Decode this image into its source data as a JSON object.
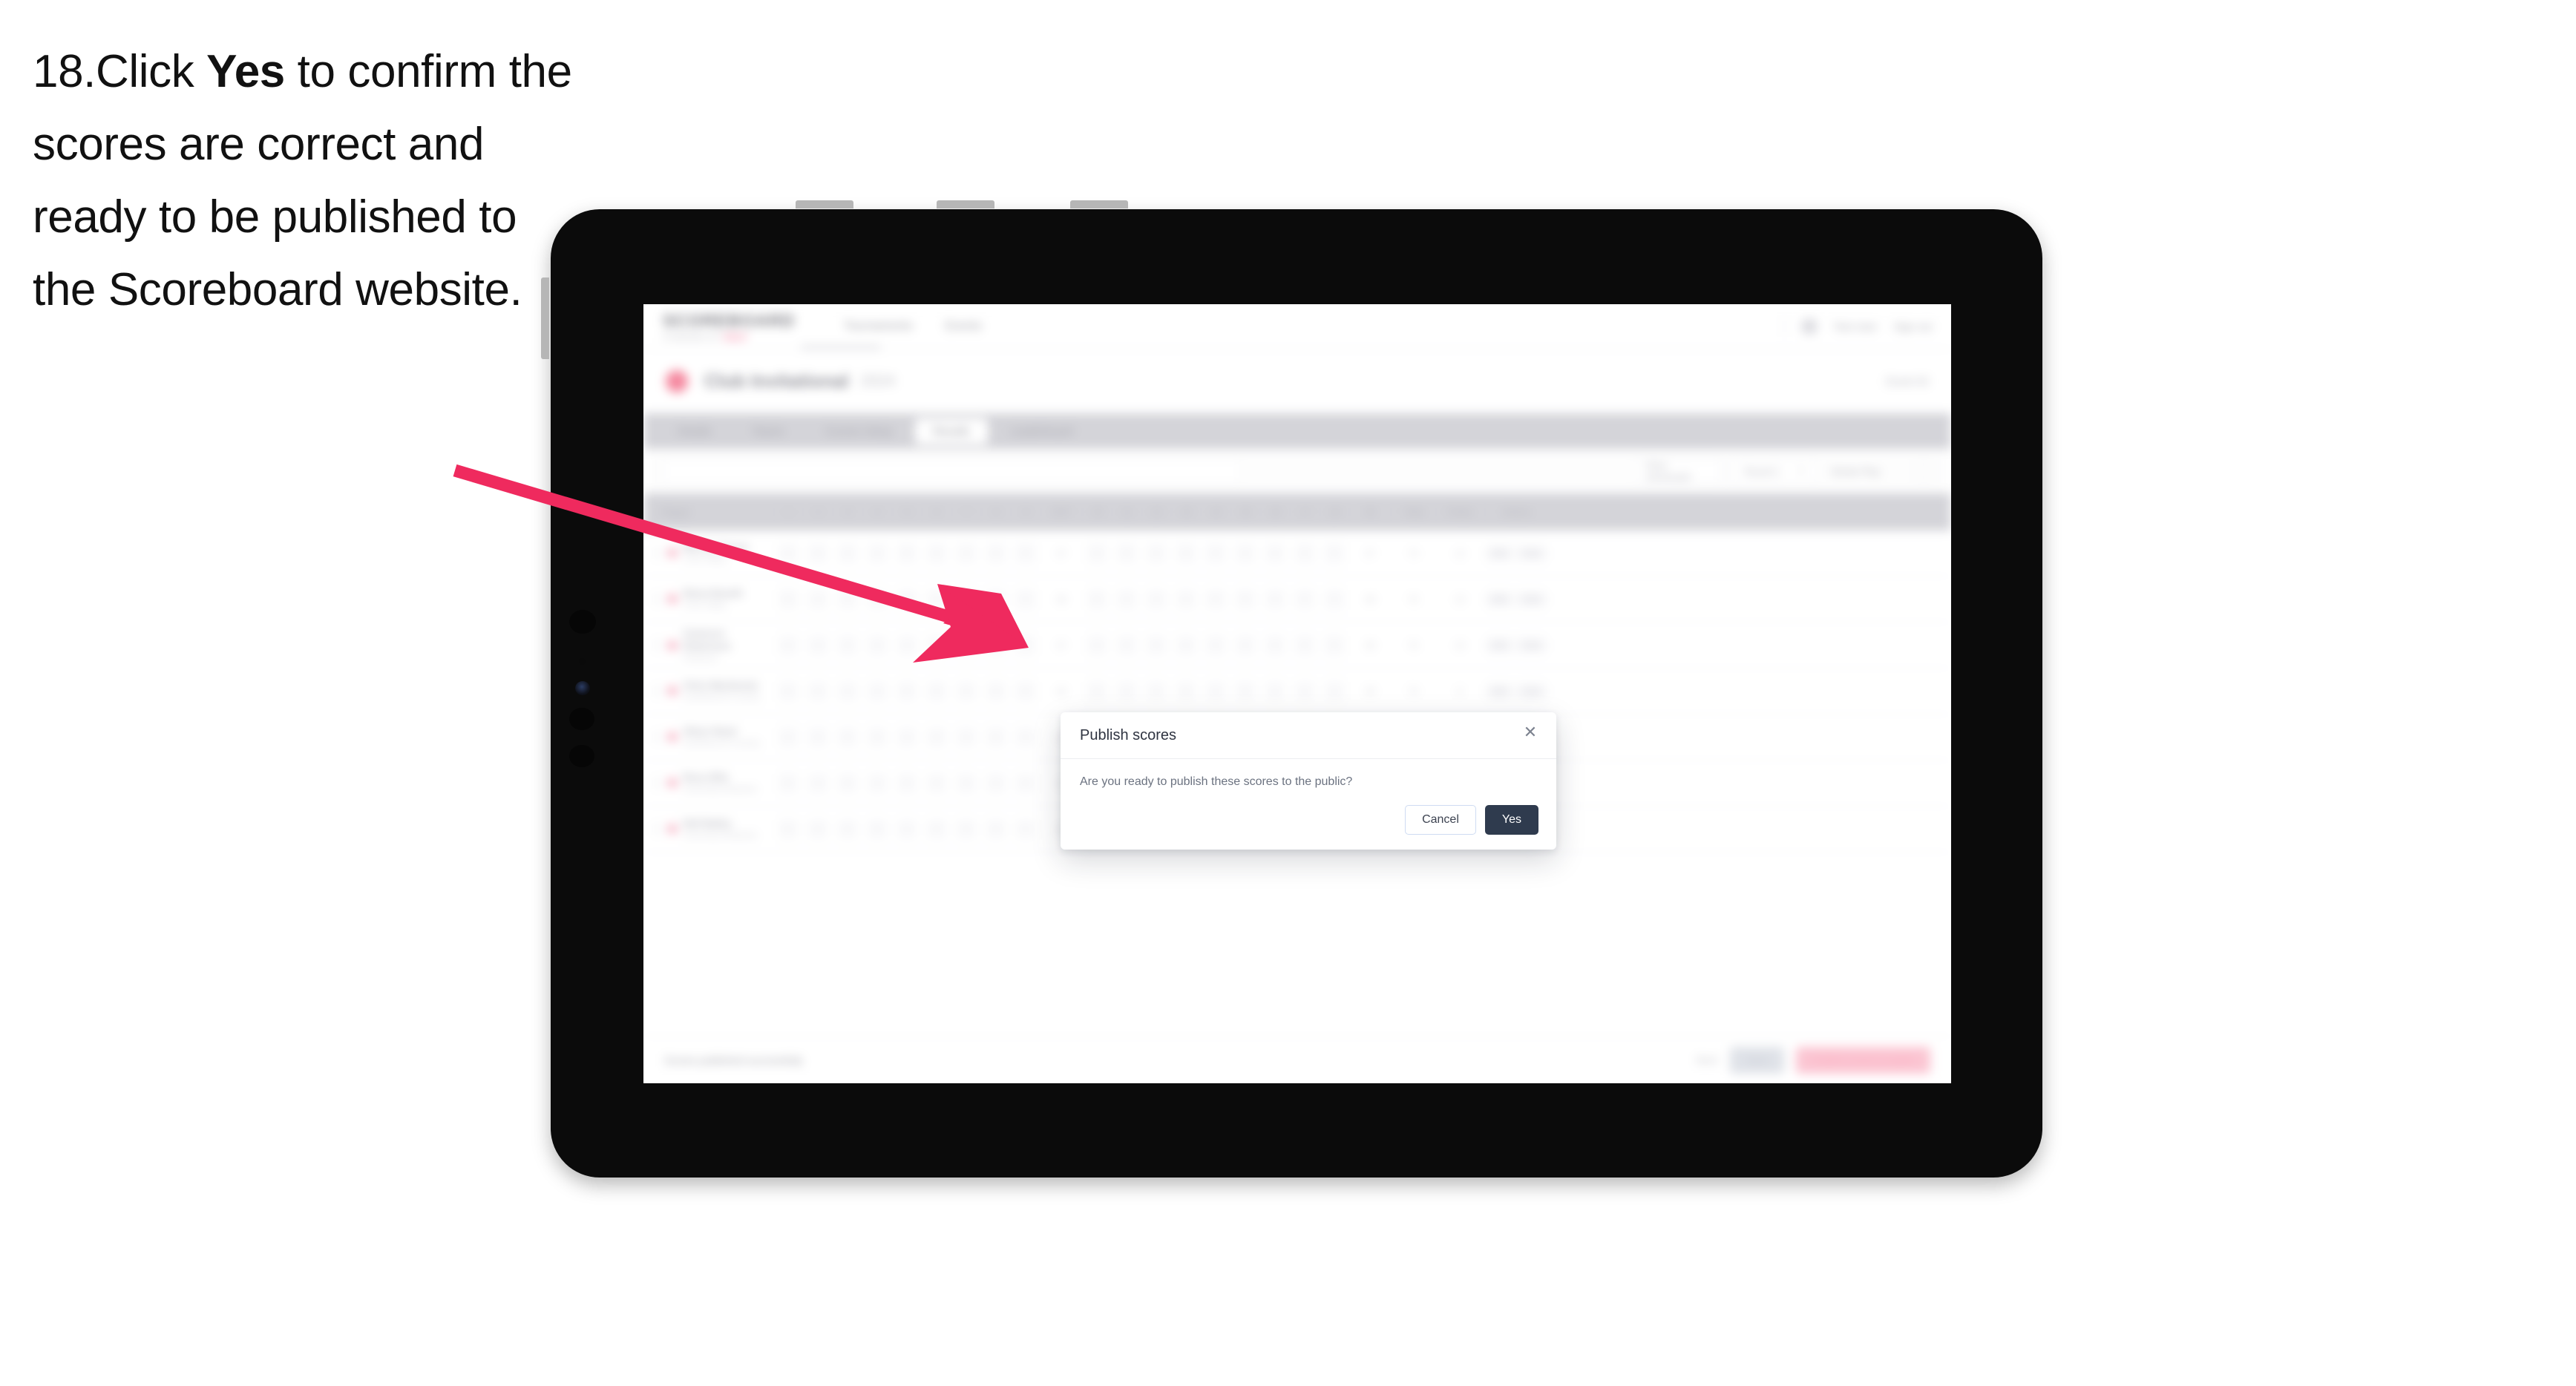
{
  "caption": {
    "number": "18.",
    "pre": "Click ",
    "bold": "Yes",
    "post": " to confirm the scores are correct and ready to be published to the Scoreboard website."
  },
  "app": {
    "logo": "SCOREBOARD",
    "logo_sub": "POWERED BY",
    "logo_pill": "GOLF",
    "nav": [
      {
        "label": "Tournaments"
      },
      {
        "label": "Events"
      }
    ],
    "header_right": {
      "avatar_icon": "user-avatar-icon",
      "user": "Test User",
      "signout": "Sign out"
    },
    "event": {
      "icon": "event-badge-icon",
      "title": "Club Invitational",
      "subtitle": "2024",
      "right": "Event ID"
    },
    "tabs": [
      {
        "label": "Details"
      },
      {
        "label": "Teams"
      },
      {
        "label": "Course Setup"
      },
      {
        "label": "Results"
      },
      {
        "label": "Leaderboard"
      }
    ],
    "active_tab": "Results",
    "filters": {
      "search_placeholder": "Search players",
      "buttons": [
        {
          "label": "Print Scorecard"
        },
        {
          "label": "Round 1"
        },
        {
          "label": "Stroke Play"
        }
      ],
      "settings_icon": "settings-icon"
    },
    "table": {
      "columns": {
        "player": "Player",
        "holes": [
          "1",
          "2",
          "3",
          "4",
          "5",
          "6",
          "7",
          "8",
          "9",
          "OUT",
          "10",
          "11",
          "12",
          "13",
          "14",
          "15",
          "16",
          "17",
          "18",
          "IN"
        ],
        "total": "Total",
        "points": "Points",
        "actions": "Actions"
      },
      "rows": [
        {
          "name": "Marcus Turner",
          "club": "Crest Valley",
          "scores": [
            "4",
            "5",
            "3",
            "4",
            "5",
            "4",
            "3",
            "4",
            "5",
            "37",
            "4",
            "5",
            "4",
            "3",
            "5",
            "4",
            "4",
            "3",
            "5",
            "37"
          ],
          "total": "74",
          "points": "12",
          "action_primary": "Edit",
          "action_secondary": "View"
        },
        {
          "name": "Elena Ravelli",
          "club": "Crest Valley",
          "scores": [
            "5",
            "4",
            "4",
            "3",
            "5",
            "4",
            "4",
            "5",
            "4",
            "38",
            "5",
            "4",
            "3",
            "4",
            "5",
            "5",
            "4",
            "4",
            "4",
            "38"
          ],
          "total": "76",
          "points": "10",
          "action_primary": "Edit",
          "action_secondary": "View"
        },
        {
          "name": "Cameron Robertson",
          "club": "Pinehurst",
          "scores": [
            "4",
            "4",
            "5",
            "4",
            "4",
            "5",
            "3",
            "4",
            "4",
            "37",
            "4",
            "5",
            "5",
            "4",
            "4",
            "4",
            "3",
            "5",
            "5",
            "39"
          ],
          "total": "76",
          "points": "10",
          "action_primary": "Edit",
          "action_secondary": "View"
        },
        {
          "name": "Chris Mackenzie",
          "club": "Southbourne Country",
          "scores": [
            "5",
            "5",
            "4",
            "4",
            "5",
            "4",
            "4",
            "4",
            "5",
            "40",
            "5",
            "4",
            "4",
            "5",
            "4",
            "5",
            "4",
            "4",
            "4",
            "39"
          ],
          "total": "79",
          "points": "8",
          "action_primary": "Edit",
          "action_secondary": "View"
        },
        {
          "name": "Oliver Reed",
          "club": "Southbourne Country",
          "scores": [
            "4",
            "5",
            "5",
            "5",
            "4",
            "5",
            "4",
            "5",
            "4",
            "41",
            "4",
            "5",
            "5",
            "4",
            "5",
            "4",
            "5",
            "4",
            "5",
            "41"
          ],
          "total": "82",
          "points": "6",
          "action_primary": "Edit",
          "action_secondary": "View"
        },
        {
          "name": "Ross Ellis",
          "club": "Greenway Meadows",
          "scores": [
            "5",
            "4",
            "5",
            "4",
            "5",
            "5",
            "5",
            "4",
            "5",
            "42",
            "5",
            "4",
            "5",
            "5",
            "4",
            "5",
            "4",
            "5",
            "4",
            "41"
          ],
          "total": "83",
          "points": "5",
          "action_primary": "Edit",
          "action_secondary": "View"
        },
        {
          "name": "Nell Bailey",
          "club": "Greenway Meadows",
          "scores": [
            "5",
            "5",
            "5",
            "5",
            "4",
            "5",
            "5",
            "5",
            "4",
            "43",
            "4",
            "5",
            "5",
            "5",
            "5",
            "4",
            "5",
            "5",
            "5",
            "43"
          ],
          "total": "86",
          "points": "4",
          "action_primary": "Edit",
          "action_secondary": "View"
        }
      ]
    },
    "footer": {
      "note": "Scores published successfully",
      "link": "Back",
      "button_grey": "Save",
      "button_pink": "Publish scores to public"
    }
  },
  "modal": {
    "title": "Publish scores",
    "close_icon": "close-icon",
    "message": "Are you ready to publish these scores to the public?",
    "cancel_label": "Cancel",
    "confirm_label": "Yes"
  },
  "annotation": {
    "arrow_color": "#ef2a5e"
  }
}
